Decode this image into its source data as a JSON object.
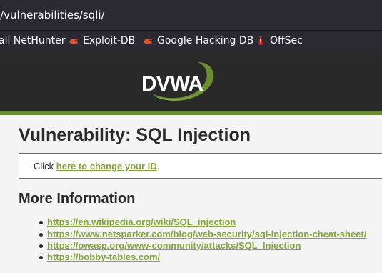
{
  "browser": {
    "url": "/vulnerabilities/sqli/",
    "bookmarks": [
      {
        "label": "ali NetHunter",
        "icon": "kali-dragon-icon"
      },
      {
        "label": "Exploit-DB",
        "icon": "exploit-db-icon"
      },
      {
        "label": "Google Hacking DB",
        "icon": "ghdb-icon"
      },
      {
        "label": "OffSec",
        "icon": "offsec-icon"
      }
    ]
  },
  "header": {
    "logo_text": "DVWA"
  },
  "main": {
    "title": "Vulnerability: SQL Injection",
    "vuln_box": {
      "prefix": "Click ",
      "link_label": "here to change your ID",
      "suffix": "."
    },
    "more_info_heading": "More Information",
    "links": [
      "https://en.wikipedia.org/wiki/SQL_injection",
      "https://www.netsparker.com/blog/web-security/sql-injection-cheat-sheet/",
      "https://owasp.org/www-community/attacks/SQL_Injection",
      "https://bobby-tables.com/"
    ]
  },
  "colors": {
    "link": "#83a637",
    "header_bg": "#292929",
    "accent_green": "#6c8d2f"
  }
}
